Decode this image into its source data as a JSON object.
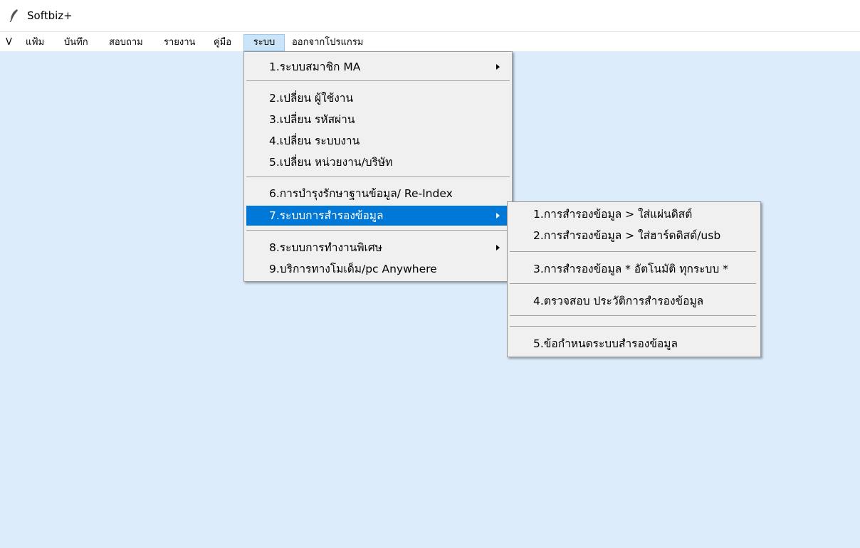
{
  "window": {
    "title": "Softbiz+",
    "icon": "feather-icon"
  },
  "menubar": {
    "items": [
      {
        "label": "V"
      },
      {
        "label": "แฟ้ม"
      },
      {
        "label": "บันทึก"
      },
      {
        "label": "สอบถาม"
      },
      {
        "label": "รายงาน"
      },
      {
        "label": "คู่มือ"
      },
      {
        "label": "ระบบ",
        "active": true
      },
      {
        "label": "ออกจากโปรแกรม"
      }
    ]
  },
  "system_menu": {
    "items": [
      {
        "label": "1.ระบบสมาชิก MA",
        "submenu": true
      },
      {
        "label": "2.เปลี่ยน ผู้ใช้งาน"
      },
      {
        "label": "3.เปลี่ยน รหัสผ่าน"
      },
      {
        "label": "4.เปลี่ยน ระบบงาน"
      },
      {
        "label": "5.เปลี่ยน หน่วยงาน/บริษัท"
      },
      {
        "label": "6.การบำรุงรักษาฐานข้อมูล/ Re-Index"
      },
      {
        "label": "7.ระบบการสำรองข้อมูล",
        "submenu": true,
        "highlighted": true
      },
      {
        "label": "8.ระบบการทำงานพิเศษ",
        "submenu": true
      },
      {
        "label": "9.บริการทางโมเด็ม/pc Anywhere"
      }
    ]
  },
  "backup_submenu": {
    "items": [
      {
        "label": "1.การสำรองข้อมูล > ใส่แผ่นดิสต์"
      },
      {
        "label": "2.การสำรองข้อมูล > ใส่ฮาร์ดดิสต์/usb"
      },
      {
        "label": "3.การสำรองข้อมูล * อัตโนมัติ ทุกระบบ *"
      },
      {
        "label": "4.ตรวจสอบ ประวัติการสำรองข้อมูล"
      },
      {
        "label": "5.ข้อกำหนดระบบสำรองข้อมูล"
      }
    ]
  },
  "colors": {
    "workspace": "#dcecfb",
    "menu_bg": "#f0f0f0",
    "highlight": "#0078d7",
    "menubar_active": "#cce4f7"
  }
}
